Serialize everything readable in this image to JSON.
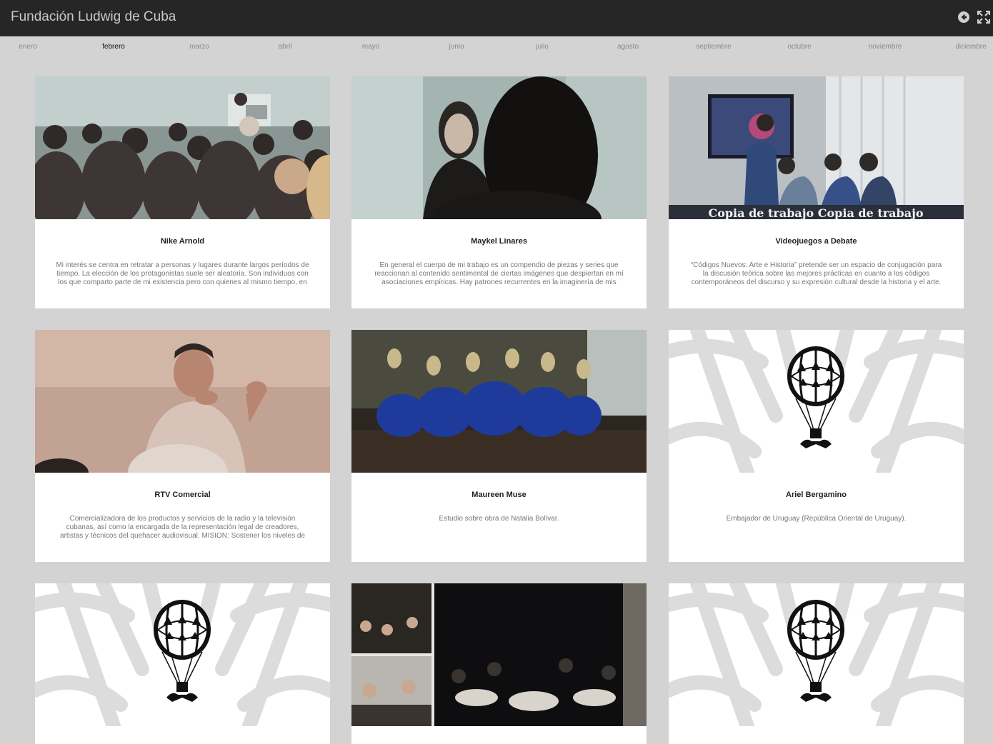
{
  "header": {
    "title": "Fundación Ludwig de Cuba",
    "back_icon": "back-arrow-icon",
    "fullscreen_icon": "fullscreen-icon"
  },
  "months": {
    "active": "febrero",
    "items": [
      "enero",
      "febrero",
      "marzo",
      "abril",
      "mayo",
      "junio",
      "julio",
      "agosto",
      "septiembre",
      "octubre",
      "noviembre",
      "diciembre"
    ]
  },
  "cards": [
    {
      "title": "Nike Arnold",
      "description": "Mi interés se centra en retratar a personas y lugares durante largos períodos de tiempo. La elección de los protagonistas suele ser aleatoria. Son individuos con los que comparto parte de mi existencia pero con quienes al mismo tiempo, en",
      "image": "audience-photo"
    },
    {
      "title": "Maykel Linares",
      "description": "En general el cuerpo de mi trabajo es un compendio de piezas y series que reaccionan al contenido sentimental de ciertas imágenes que despiertan en mí asociaciones empíricas. Hay patrones recurrentes en la imaginería de mis",
      "image": "woman-speaking-photo"
    },
    {
      "title": "Videojuegos a Debate",
      "description": "“Códigos Nuevos: Arte e Historia” pretende ser un espacio de conjugación para la discusión teórica sobre las mejores prácticas en cuanto a los códigos contemporáneos del discurso y su expresión cultural desde la historia y el arte.",
      "image": "debate-photo",
      "image_caption": "Copia de trabajo Copia de trabajo"
    },
    {
      "title": "RTV Comercial",
      "description": "Comercializadora de los productos y servicios de la radio y la televisión cubanas, así como la encargada de la representación legal de creadores, artistas y técnicos del quehacer audiovisual. MISION: Sostener los niveles de",
      "image": "man-speaking-photo"
    },
    {
      "title": "Maureen Muse",
      "description": "Estudio sobre obra de Natalia Bolívar.",
      "image": "dancers-photo"
    },
    {
      "title": "Ariel Bergamino",
      "description": "Embajador de Uruguay (República Oriental de Uruguay).",
      "image": "balloon-logo"
    },
    {
      "title": "",
      "description": "",
      "image": "balloon-logo"
    },
    {
      "title": "",
      "description": "",
      "image": "reception-collage-photo"
    },
    {
      "title": "",
      "description": "",
      "image": "balloon-logo"
    }
  ],
  "colors": {
    "background": "#d3d3d3",
    "topbar": "#262626",
    "card": "#ffffff",
    "active_month": "#111111",
    "inactive_month": "#8a8a8a"
  }
}
